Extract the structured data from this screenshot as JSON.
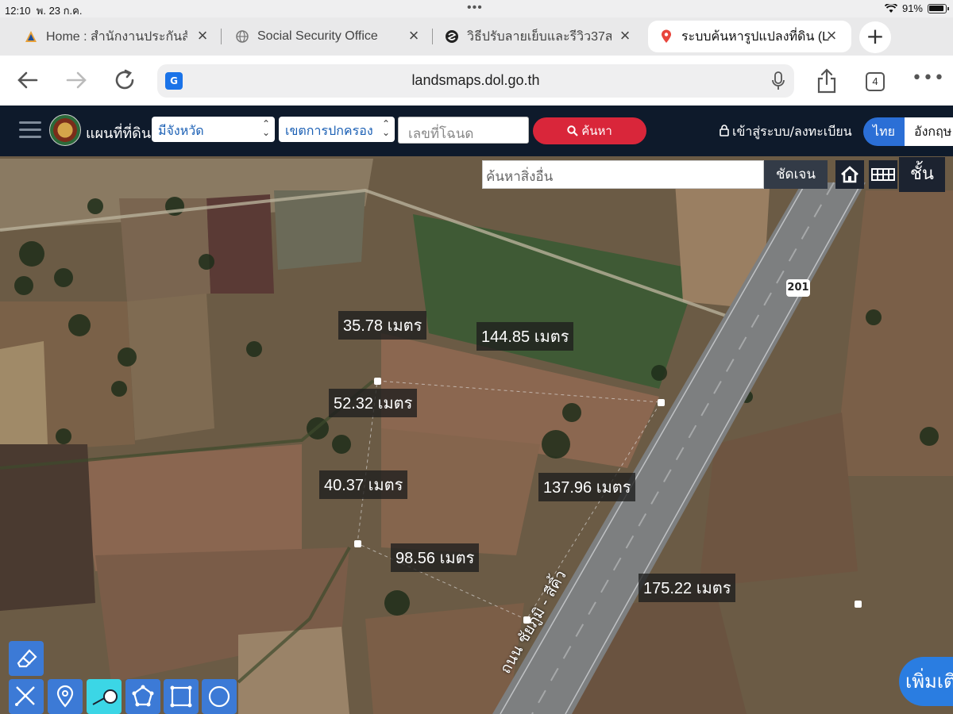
{
  "status_bar": {
    "time": "12:10",
    "date": "พ. 23 ก.ค.",
    "battery": "91%"
  },
  "tabs": [
    {
      "title": "Home : สำนักงานประกันสัง",
      "active": false
    },
    {
      "title": "Social Security Office",
      "active": false
    },
    {
      "title": "วิธีปรับลายเย็บและรีวิว37สา",
      "active": false
    },
    {
      "title": "ระบบค้นหารูปแปลงที่ดิน (La",
      "active": true
    }
  ],
  "address_bar": {
    "url": "landsmaps.dol.go.th",
    "tab_count": "4"
  },
  "site_header": {
    "title": "แผนที่ที่ดิน",
    "province_select": "มีจังหวัด",
    "district_select": "เขตการปกครอง",
    "deed_placeholder": "เลขที่โฉนด",
    "search_label": "ค้นหา",
    "login_label": "เข้าสู่ระบบ/ลงทะเบียน",
    "lang_thai": "ไทย",
    "lang_en": "อังกฤษ"
  },
  "map": {
    "other_search_placeholder": "ค้นหาสิ่งอื่น",
    "clear_label": "ชัดเจน",
    "layers_label": "ชั้น",
    "route_number": "201",
    "road_name": "ถนน ชัยภูมิ - สีคิ้ว",
    "more_label": "เพิ่มเติม",
    "measurements": [
      {
        "label": "35.78 เมตร"
      },
      {
        "label": "144.85 เมตร"
      },
      {
        "label": "52.32 เมตร"
      },
      {
        "label": "40.37 เมตร"
      },
      {
        "label": "137.96 เมตร"
      },
      {
        "label": "98.56 เมตร"
      },
      {
        "label": "175.22 เมตร"
      }
    ]
  }
}
